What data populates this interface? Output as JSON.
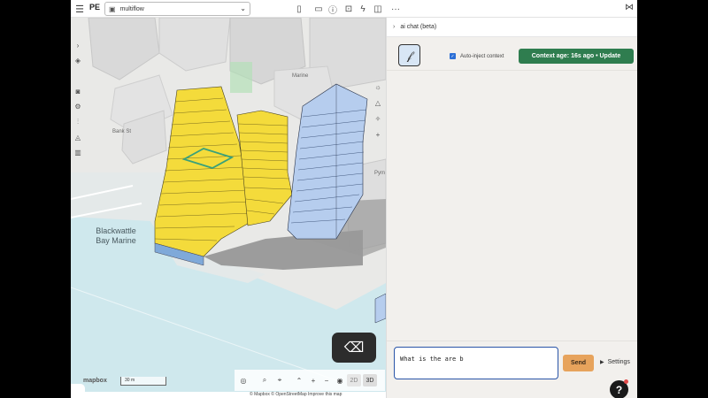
{
  "topbar": {
    "logo": "PE",
    "project_name": "multiflow",
    "tools": [
      "document-icon",
      "comment-icon",
      "info-icon",
      "lock-icon",
      "bolt-icon",
      "cube-icon",
      "more-icon"
    ],
    "more_label": "···"
  },
  "map": {
    "labels": {
      "water": "Blackwattle Bay Marine",
      "street_bank": "Bank St",
      "street_pym": "Pym",
      "marine_small": "Marine"
    },
    "scale_label": "30 m",
    "mapbox_logo": "mapbox",
    "view_2d": "2D",
    "view_3d": "3D",
    "attribution": "© Mapbox © OpenStreetMap  Improve this map"
  },
  "chat": {
    "title": "ai chat (beta)",
    "auto_inject_label": "Auto-inject context",
    "auto_inject_checked": true,
    "context_age_label": "Context age: 16s ago • Update",
    "input_value": "What is the are b",
    "send_label": "Send",
    "settings_label": "Settings"
  },
  "colors": {
    "accent_blue": "#2a55a8",
    "context_green": "#2f7d4f",
    "send_orange": "#e7a35c",
    "building_yellow": "#f4db3b",
    "building_blue": "#b6cdee",
    "water": "#cfe8ed"
  }
}
